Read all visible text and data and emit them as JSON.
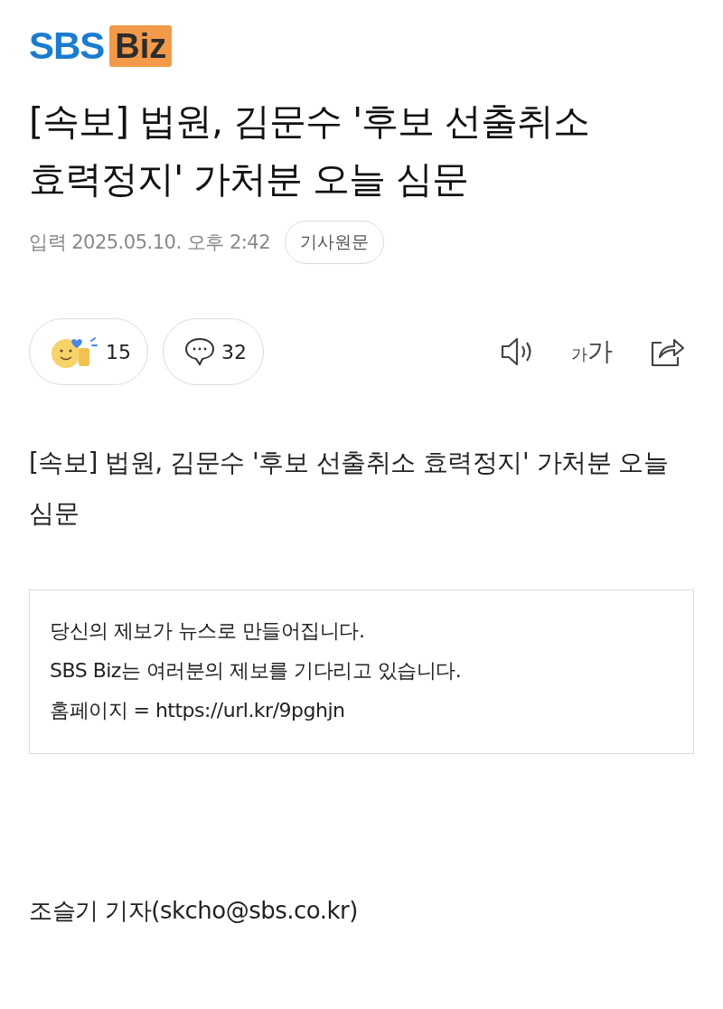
{
  "logo": {
    "part_1": "SBS",
    "part_2": "Biz"
  },
  "headline": "[속보] 법원, 김문수 '후보 선출취소 효력정지' 가처분 오늘 심문",
  "meta": {
    "date": "입력 2025.05.10. 오후 2:42",
    "source_button": "기사원문"
  },
  "actions": {
    "reactions": "15",
    "comments": "32",
    "font_size": {
      "small": "가",
      "large": "가"
    }
  },
  "body": "[속보] 법원, 김문수 '후보 선출취소 효력정지' 가처분 오늘 심문",
  "notice": [
    "당신의 제보가 뉴스로 만들어집니다.",
    "SBS Biz는 여러분의 제보를 기다리고 있습니다.",
    "홈페이지 = https://url.kr/9pghjn"
  ],
  "byline": "조슬기 기자(skcho@sbs.co.kr)"
}
